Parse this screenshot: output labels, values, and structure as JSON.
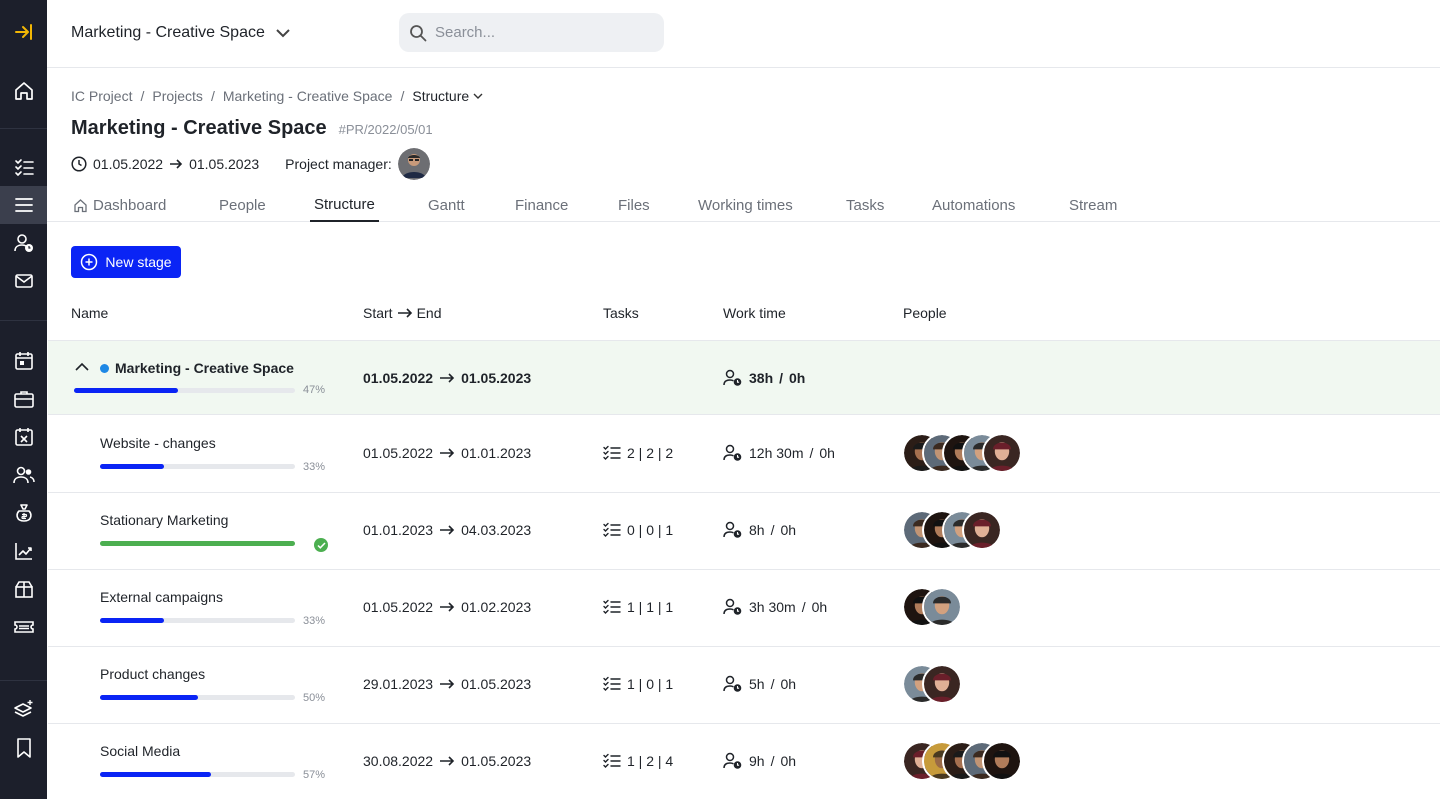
{
  "header": {
    "workspace_title": "Marketing - Creative Space",
    "search_placeholder": "Search..."
  },
  "breadcrumb": [
    "IC Project",
    "Projects",
    "Marketing - Creative Space",
    "Structure"
  ],
  "project": {
    "title": "Marketing - Creative Space",
    "code": "#PR/2022/05/01",
    "start": "01.05.2022",
    "end": "01.05.2023",
    "manager_label": "Project manager:"
  },
  "tabs": [
    "Dashboard",
    "People",
    "Structure",
    "Gantt",
    "Finance",
    "Files",
    "Working times",
    "Tasks",
    "Automations",
    "Stream"
  ],
  "actions": {
    "new_stage": "New stage"
  },
  "columns": {
    "name": "Name",
    "start": "Start",
    "end": "End",
    "tasks": "Tasks",
    "work_time": "Work time",
    "people": "People"
  },
  "parent": {
    "name": "Marketing - Creative Space",
    "progress": 47,
    "progress_label": "47%",
    "start": "01.05.2022",
    "end": "01.05.2023",
    "work_time": "38h",
    "work_plan": "0h"
  },
  "stages": [
    {
      "name": "Website - changes",
      "progress": 33,
      "progress_label": "33%",
      "done": false,
      "start": "01.05.2022",
      "end": "01.01.2023",
      "tasks": "2 | 2 | 2",
      "work_time": "12h 30m",
      "work_plan": "0h",
      "people_count": 5
    },
    {
      "name": "Stationary Marketing",
      "progress": 100,
      "progress_label": "",
      "done": true,
      "start": "01.01.2023",
      "end": "04.03.2023",
      "tasks": "0 | 0 | 1",
      "work_time": "8h",
      "work_plan": "0h",
      "people_count": 4
    },
    {
      "name": "External campaigns",
      "progress": 33,
      "progress_label": "33%",
      "done": false,
      "start": "01.05.2022",
      "end": "01.02.2023",
      "tasks": "1 | 1 | 1",
      "work_time": "3h 30m",
      "work_plan": "0h",
      "people_count": 2
    },
    {
      "name": "Product changes",
      "progress": 50,
      "progress_label": "50%",
      "done": false,
      "start": "29.01.2023",
      "end": "01.05.2023",
      "tasks": "1 | 0 | 1",
      "work_time": "5h",
      "work_plan": "0h",
      "people_count": 2
    },
    {
      "name": "Social Media",
      "progress": 57,
      "progress_label": "57%",
      "done": false,
      "start": "30.08.2022",
      "end": "01.05.2023",
      "tasks": "1 | 2 | 4",
      "work_time": "9h",
      "work_plan": "0h",
      "people_count": 5
    }
  ],
  "colors": {
    "sidebar_bg": "#1c1f2b",
    "accent_icon": "#f2b705",
    "primary": "#0a24f5",
    "done_green": "#4caf50",
    "parent_row_bg": "#f1f8f1"
  },
  "sidebar_icons": [
    "expand-sidebar-icon",
    "home-icon",
    "checklist-icon",
    "menu-lines-icon",
    "user-clock-icon",
    "mail-icon",
    "calendar-icon",
    "briefcase-icon",
    "calendar-x-icon",
    "users-icon",
    "money-bag-icon",
    "chart-icon",
    "gift-box-icon",
    "ticket-icon",
    "layers-plus-icon",
    "bookmark-icon"
  ]
}
